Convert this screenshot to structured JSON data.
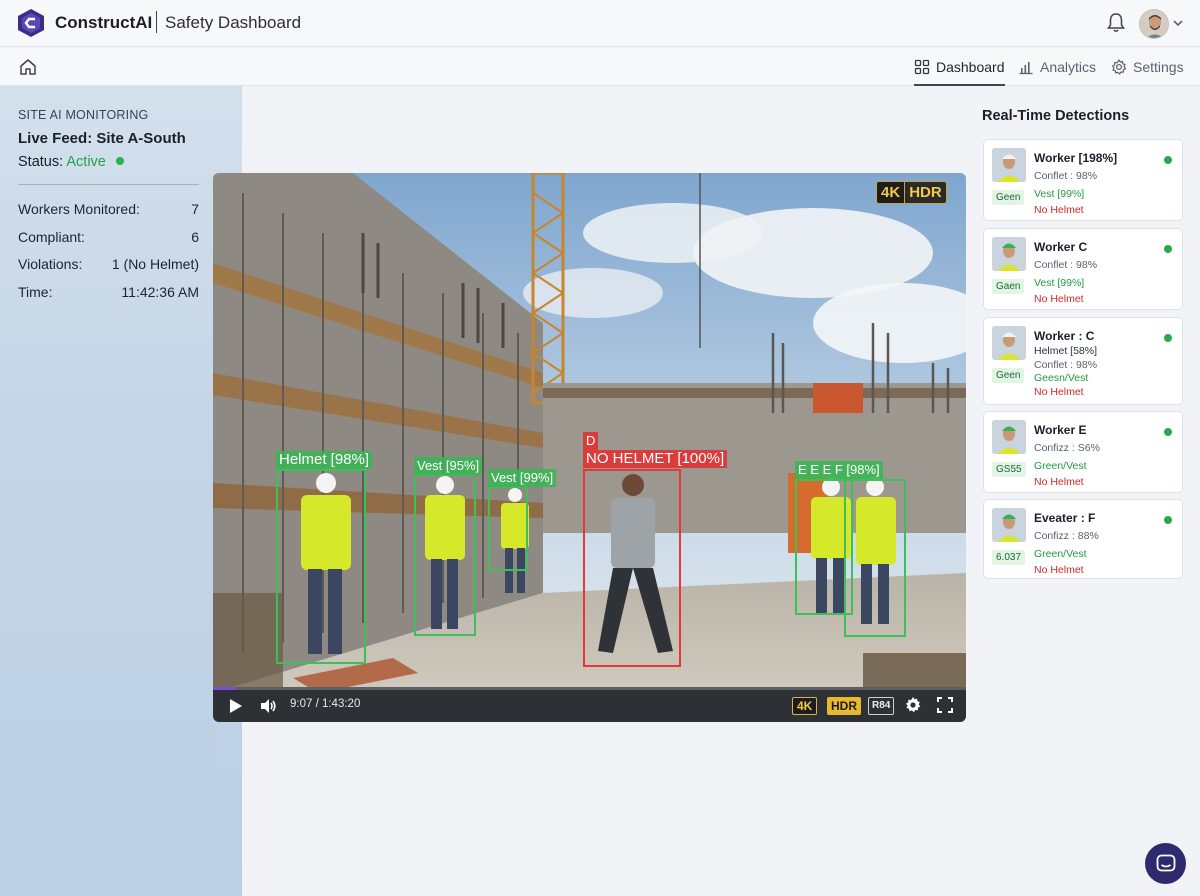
{
  "header": {
    "brand": "ConstructAI",
    "subtitle": "Safety Dashboard"
  },
  "nav": {
    "tabs": [
      {
        "label": "Dashboard",
        "icon": "grid-icon",
        "active": true
      },
      {
        "label": "Analytics",
        "icon": "bar-chart-icon",
        "active": false
      },
      {
        "label": "Settings",
        "icon": "gear-icon",
        "active": false
      }
    ]
  },
  "monitor": {
    "eyebrow": "SITE AI MONITORING",
    "title": "Live Feed: Site A-South",
    "status_label": "Status:",
    "status_value": "Active",
    "stats": [
      {
        "label": "Workers Monitored:",
        "value": "7"
      },
      {
        "label": "Compliant:",
        "value": "6"
      },
      {
        "label": "Violations:",
        "value": "1 (No Helmet)"
      },
      {
        "label": "Time:",
        "value": "11:42:36 AM"
      }
    ]
  },
  "video": {
    "badge_4k": "4K",
    "badge_hdr": "HDR",
    "detections": [
      {
        "label": "Helmet [98%]",
        "color": "green"
      },
      {
        "label": "Vest [95%]",
        "color": "green"
      },
      {
        "label": "Vest [99%]",
        "color": "green"
      },
      {
        "label": "D",
        "color": "red"
      },
      {
        "label": "NO HELMET [100%]",
        "color": "red"
      },
      {
        "label": "E E E F [98%]",
        "color": "green"
      }
    ],
    "controls": {
      "time": "9:07 / 1:43:20",
      "quality": "4K",
      "hdr": "HDR",
      "cc": "R84"
    },
    "progress": 0.03
  },
  "detections_panel": {
    "title": "Real-Time Detections",
    "cards": [
      {
        "name": "Worker [198%]",
        "tag": "Geen",
        "lines": [
          {
            "text": "Conflet : 98%",
            "tone": "gray"
          },
          {
            "text": "Vest [99%]",
            "tone": "green"
          },
          {
            "text": "No Helmet",
            "tone": "red"
          }
        ]
      },
      {
        "name": "Worker C",
        "tag": "Gaen",
        "lines": [
          {
            "text": "Conflet : 98%",
            "tone": "gray"
          },
          {
            "text": "Vest [99%]",
            "tone": "green"
          },
          {
            "text": "No Helmet",
            "tone": "red"
          }
        ]
      },
      {
        "name": "Worker : C",
        "tag": "Geen",
        "lines": [
          {
            "text": "Helmet [58%]",
            "tone": "dark"
          },
          {
            "text": "Conflet : 98%",
            "tone": "gray"
          },
          {
            "text": "Geesn/Vest",
            "tone": "green"
          },
          {
            "text": "No Helmet",
            "tone": "red"
          }
        ]
      },
      {
        "name": "Worker E",
        "tag": "GS55",
        "lines": [
          {
            "text": "Confizz : S6%",
            "tone": "gray"
          },
          {
            "text": "Green/Vest",
            "tone": "green"
          },
          {
            "text": "No Helmet",
            "tone": "red"
          }
        ]
      },
      {
        "name": "Eveater : F",
        "tag": "6.037",
        "lines": [
          {
            "text": "Confizz : 88%",
            "tone": "gray"
          },
          {
            "text": "Green/Vest",
            "tone": "green"
          },
          {
            "text": "No Helmet",
            "tone": "red"
          }
        ]
      }
    ]
  },
  "colors": {
    "accent": "#3d4558",
    "ok": "#27b04f",
    "alert": "#e23a3a",
    "chat": "#2e2a6e"
  }
}
